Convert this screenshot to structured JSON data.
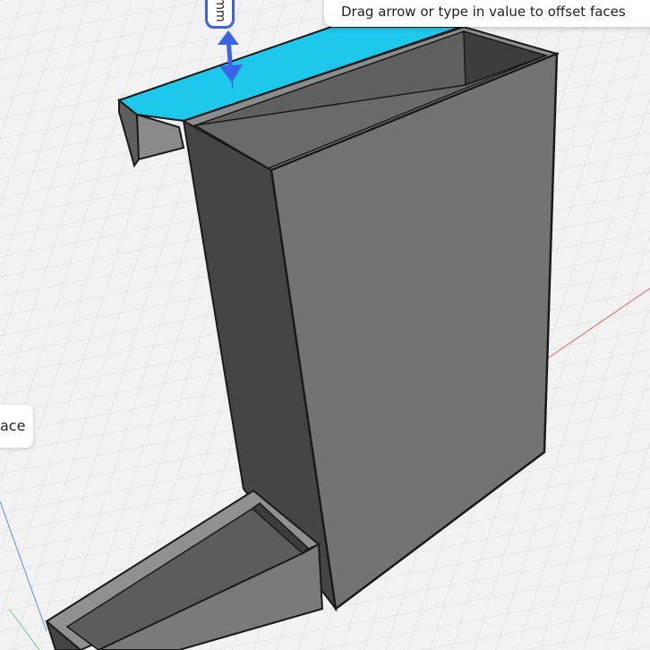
{
  "viewport": {
    "grid_color": "#d7d7d7",
    "background_color": "#f2f2f2",
    "x_axis_color": "#e06666",
    "z_axis_color": "#5b8fe0",
    "model_face_light": "#737373",
    "model_face_dark": "#454545",
    "model_edge": "#1a1a1a",
    "selected_face_color": "#1ec8ea"
  },
  "hint_tooltip": {
    "text": "Drag arrow or type in value to offset faces"
  },
  "side_chip": {
    "text": "ace"
  },
  "offset_manipulator": {
    "icon": "double-arrow-icon",
    "value_unit": "mm",
    "color": "#3b63e6"
  }
}
